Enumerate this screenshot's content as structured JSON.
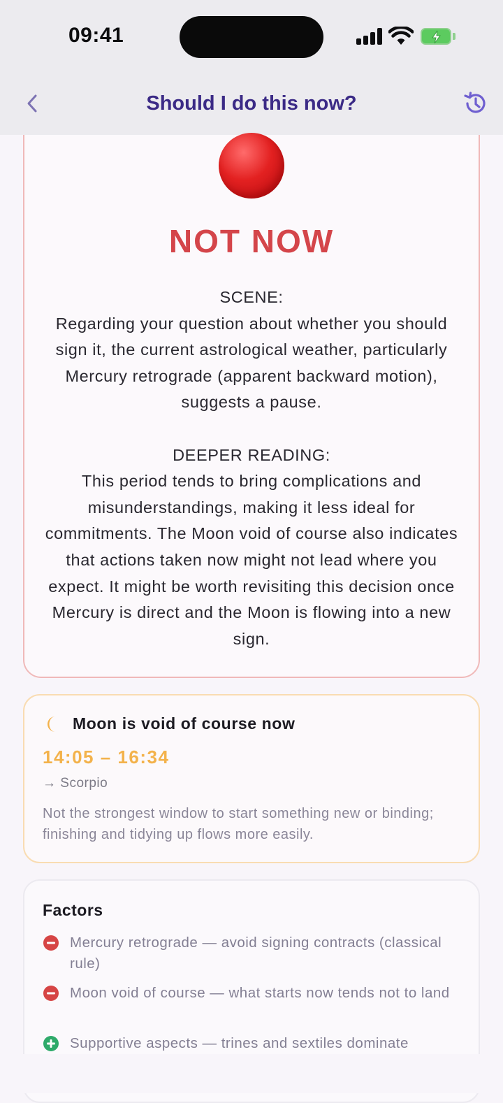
{
  "status_bar": {
    "time": "09:41"
  },
  "nav": {
    "title": "Should I do this now?"
  },
  "verdict": {
    "label": "NOT NOW",
    "scene_heading": "SCENE:",
    "scene_text": "Regarding your question about whether you should sign it, the current astrological weather, particularly Mercury retrograde (apparent backward motion), suggests a pause.",
    "deeper_heading": "DEEPER READING:",
    "deeper_text": "This period tends to bring complications and misunderstandings, making it less ideal for commitments. The Moon void of course also indicates that actions taken now might not lead where you expect. It might be worth revisiting this decision once Mercury is direct and the Moon is flowing into a new sign."
  },
  "moon": {
    "title": "Moon is void of course now",
    "window": "14:05 – 16:34",
    "next_sign": "→ Scorpio",
    "note": "Not the strongest window to start something new or binding; finishing and tidying up flows more easily."
  },
  "factors": {
    "title": "Factors",
    "items": [
      {
        "type": "negative",
        "text": "Mercury retrograde — avoid signing contracts (classical rule)"
      },
      {
        "type": "negative",
        "text": "Moon void of course — what starts now tends not to land"
      },
      {
        "type": "positive",
        "text": "Supportive aspects — trines and sextiles dominate"
      }
    ]
  },
  "colors": {
    "nav_title": "#3b2a86",
    "verdict_red": "#d4454a",
    "moon_accent": "#f3b24b",
    "negative": "#d64545",
    "positive": "#2eaa6a"
  }
}
